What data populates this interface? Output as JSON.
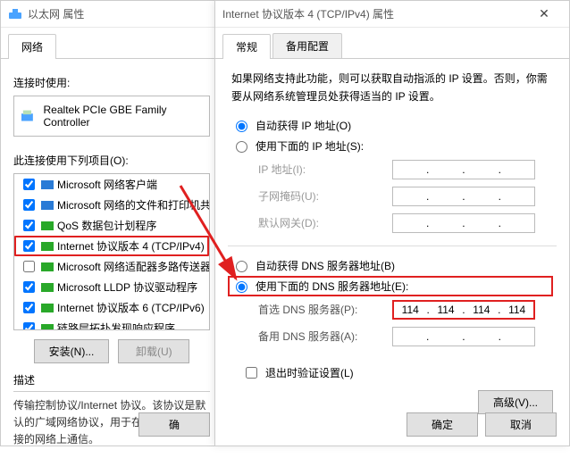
{
  "win1": {
    "title": "以太网 属性",
    "tab": "网络",
    "connect_label": "连接时使用:",
    "adapter": "Realtek PCIe GBE Family Controller",
    "items_label": "此连接使用下列项目(O):",
    "items": [
      {
        "checked": true,
        "icon_color": "#2a7bd6",
        "label": "Microsoft 网络客户端"
      },
      {
        "checked": true,
        "icon_color": "#2a7bd6",
        "label": "Microsoft 网络的文件和打印机共享"
      },
      {
        "checked": true,
        "icon_color": "#29a829",
        "label": "QoS 数据包计划程序"
      },
      {
        "checked": true,
        "icon_color": "#29a829",
        "label": "Internet 协议版本 4 (TCP/IPv4)",
        "selected": true
      },
      {
        "checked": false,
        "icon_color": "#29a829",
        "label": "Microsoft 网络适配器多路传送器协议"
      },
      {
        "checked": true,
        "icon_color": "#29a829",
        "label": "Microsoft LLDP 协议驱动程序"
      },
      {
        "checked": true,
        "icon_color": "#29a829",
        "label": "Internet 协议版本 6 (TCP/IPv6)"
      },
      {
        "checked": true,
        "icon_color": "#29a829",
        "label": "链路层拓扑发现响应程序"
      }
    ],
    "install_btn": "安装(N)...",
    "uninstall_btn": "卸载(U)",
    "desc_label": "描述",
    "desc_text": "传输控制协议/Internet 协议。该协议是默认的广域网络协议，用于在不同的相互连接的网络上通信。",
    "ok_btn": "确"
  },
  "win2": {
    "title": "Internet 协议版本 4 (TCP/IPv4) 属性",
    "tab_general": "常规",
    "tab_alt": "备用配置",
    "help": "如果网络支持此功能，则可以获取自动指派的 IP 设置。否则，你需要从网络系统管理员处获得适当的 IP 设置。",
    "radio_auto_ip": "自动获得 IP 地址(O)",
    "radio_manual_ip": "使用下面的 IP 地址(S):",
    "ip_label": "IP 地址(I):",
    "mask_label": "子网掩码(U):",
    "gw_label": "默认网关(D):",
    "radio_auto_dns": "自动获得 DNS 服务器地址(B)",
    "radio_manual_dns": "使用下面的 DNS 服务器地址(E):",
    "dns1_label": "首选 DNS 服务器(P):",
    "dns2_label": "备用 DNS 服务器(A):",
    "dns1_value": [
      "114",
      "114",
      "114",
      "114"
    ],
    "exit_validate": "退出时验证设置(L)",
    "adv_btn": "高级(V)...",
    "ok_btn": "确定",
    "cancel_btn": "取消"
  }
}
